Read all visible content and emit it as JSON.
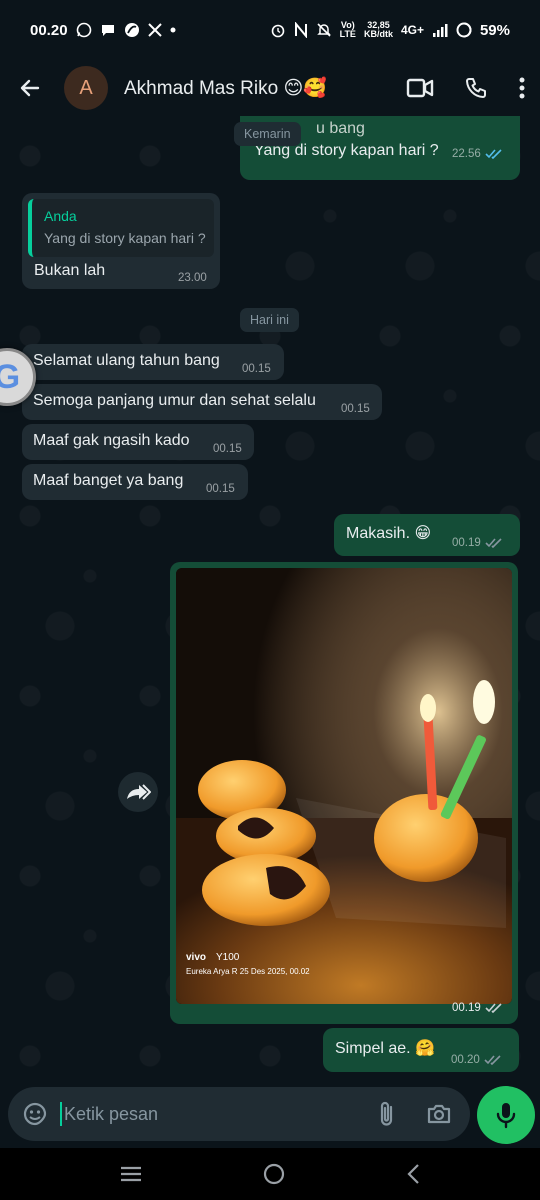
{
  "status_bar": {
    "time": "00.20",
    "net_speed_value": "32,85",
    "net_speed_unit": "KB/dtk",
    "network": "4G+",
    "volte_top": "Vo)",
    "volte_bottom": "LTE",
    "battery": "59%"
  },
  "header": {
    "avatar_letter": "A",
    "contact_name": "Akhmad Mas Riko 😊🥰"
  },
  "chat": {
    "partial_message_text": "u bang",
    "date_chip_yesterday": "Kemarin",
    "messages": [
      {
        "direction": "out",
        "text": "Yang di story kapan hari ?",
        "time": "22.56",
        "status": "read"
      },
      {
        "direction": "in",
        "quote_author": "Anda",
        "quote_text": "Yang di story kapan hari ?",
        "text": "Bukan lah",
        "time": "23.00"
      },
      {
        "direction": "in",
        "text": "Selamat ulang tahun bang",
        "time": "00.15"
      },
      {
        "direction": "in",
        "text": "Semoga panjang umur dan sehat selalu",
        "time": "00.15"
      },
      {
        "direction": "in",
        "text": "Maaf gak ngasih kado",
        "time": "00.15"
      },
      {
        "direction": "in",
        "text": "Maaf banget ya bang",
        "time": "00.15"
      },
      {
        "direction": "out",
        "text": "Makasih. 😁",
        "time": "00.19",
        "status": "delivered"
      },
      {
        "direction": "out",
        "type": "image",
        "watermark_brand": "vivo",
        "watermark_model": "Y100",
        "watermark_line": "Eureka Arya R   25 Des 2025, 00.02",
        "time": "00.19",
        "status": "delivered"
      },
      {
        "direction": "out",
        "text": "Simpel ae. 🤗",
        "time": "00.20",
        "status": "delivered"
      }
    ],
    "date_chip_today": "Hari ini",
    "google_letter": "G"
  },
  "composer": {
    "placeholder": "Ketik pesan"
  },
  "colors": {
    "outgoing_bubble": "#144d37",
    "incoming_bubble": "#202c33",
    "background": "#0b141a",
    "accent": "#21c063",
    "read_tick": "#53bdeb"
  },
  "icons": [
    "back-arrow-icon",
    "video-call-icon",
    "phone-icon",
    "more-vert-icon",
    "sticker-icon",
    "attach-icon",
    "camera-icon",
    "mic-icon",
    "forward-icon",
    "recents-icon",
    "home-icon",
    "back-nav-icon"
  ]
}
